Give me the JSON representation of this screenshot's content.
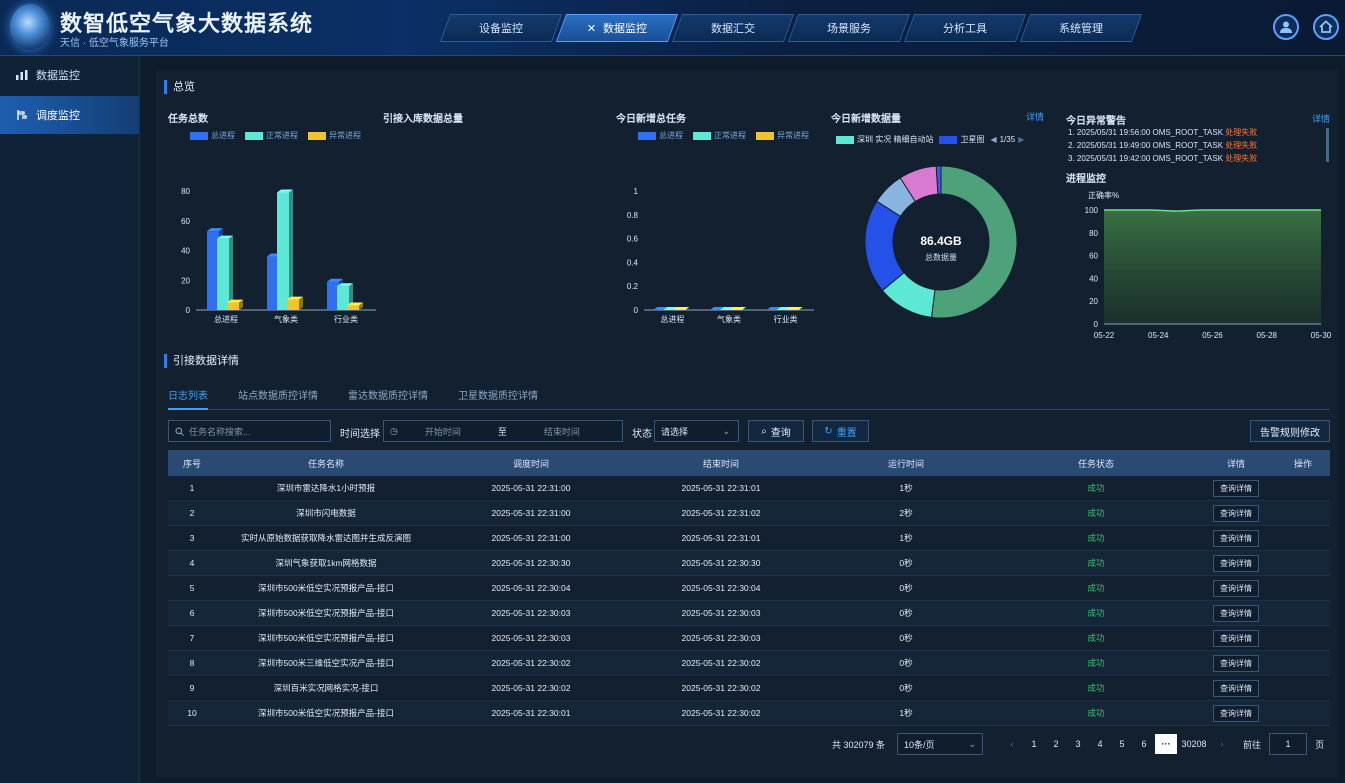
{
  "header": {
    "title": "数智低空气象大数据系统",
    "subtitle": "天信 · 低空气象服务平台",
    "nav": [
      "设备监控",
      "数据监控",
      "数据汇交",
      "场景服务",
      "分析工具",
      "系统管理"
    ]
  },
  "sidebar": {
    "items": [
      "数据监控",
      "调度监控"
    ]
  },
  "overview": {
    "title": "总览",
    "task_total_label": "任务总数",
    "ingest_total_label": "引接入库数据总量",
    "new_tasks_label": "今日新增总任务",
    "new_data_label": "今日新增数据量",
    "new_data_link": "详情",
    "alerts_label": "今日异常警告",
    "alerts_link": "详情",
    "process_label": "进程监控",
    "legend_total": "总进程",
    "legend_normal": "正常进程",
    "legend_abnormal": "异常进程",
    "donut_legend_a": "深圳 实况 精细自动站",
    "donut_legend_b": "卫星图",
    "donut_pager": "1/35",
    "donut_value": "86.4GB",
    "donut_caption": "总数据量",
    "process_axis_label": "正确率%",
    "alerts": [
      {
        "idx": "1.",
        "text": "2025/05/31 19:56:00 OMS_ROOT_TASK",
        "status": "处理失败"
      },
      {
        "idx": "2.",
        "text": "2025/05/31 19:49:00 OMS_ROOT_TASK",
        "status": "处理失败"
      },
      {
        "idx": "3.",
        "text": "2025/05/31 19:42:00 OMS_ROOT_TASK",
        "status": "处理失败"
      }
    ]
  },
  "chart_data": [
    {
      "type": "bar",
      "title": "任务总数",
      "categories": [
        "总进程",
        "气象类",
        "行业类"
      ],
      "ylim": [
        0,
        80
      ],
      "yticks": [
        0,
        20,
        40,
        60,
        80
      ],
      "series": [
        {
          "name": "总进程",
          "values": [
            53,
            36,
            19
          ],
          "color": "#2f6ff0"
        },
        {
          "name": "正常进程",
          "values": [
            48,
            79,
            16
          ],
          "color": "#5de8d6"
        },
        {
          "name": "异常进程",
          "values": [
            5,
            7,
            3
          ],
          "color": "#f0c330"
        }
      ]
    },
    {
      "type": "bar",
      "title": "今日新增总任务",
      "categories": [
        "总进程",
        "气象类",
        "行业类"
      ],
      "ylim": [
        0,
        1
      ],
      "yticks": [
        0,
        0.2,
        0.4,
        0.6,
        0.8,
        1
      ],
      "series": [
        {
          "name": "总进程",
          "values": [
            0,
            0,
            0
          ],
          "color": "#2f6ff0"
        },
        {
          "name": "正常进程",
          "values": [
            0,
            0,
            0
          ],
          "color": "#5de8d6"
        },
        {
          "name": "异常进程",
          "values": [
            0,
            0,
            0
          ],
          "color": "#f0c330"
        }
      ]
    },
    {
      "type": "pie",
      "title": "今日新增数据量",
      "slices": [
        {
          "name": "green",
          "value": 52,
          "color": "#4ea27a"
        },
        {
          "name": "cyan",
          "value": 12,
          "color": "#5de8d6"
        },
        {
          "name": "blue",
          "value": 20,
          "color": "#2452e8"
        },
        {
          "name": "lightblue",
          "value": 7,
          "color": "#8ab4e0"
        },
        {
          "name": "pink",
          "value": 8,
          "color": "#d77ad0"
        },
        {
          "name": "darkblue",
          "value": 1,
          "color": "#3f5be0"
        }
      ]
    },
    {
      "type": "area",
      "title": "进程监控",
      "ylabel": "正确率%",
      "ylim": [
        0,
        100
      ],
      "yticks": [
        0,
        20,
        40,
        60,
        80,
        100
      ],
      "xticks": [
        "05-22",
        "05-24",
        "05-26",
        "05-28",
        "05-30"
      ],
      "values": [
        100,
        100,
        100,
        99,
        100,
        100,
        100,
        100,
        100,
        100
      ]
    }
  ],
  "details": {
    "title": "引接数据详情",
    "tabs": [
      "日志列表",
      "站点数据质控详情",
      "雷达数据质控详情",
      "卫星数据质控详情"
    ],
    "search_placeholder": "任务名称搜索...",
    "time_label": "时间选择",
    "start_placeholder": "开始时间",
    "to": "至",
    "end_placeholder": "结束时间",
    "status_label": "状态",
    "status_select": "请选择",
    "query_btn": "查询",
    "reset_btn": "重置",
    "rule_btn": "告警规则修改",
    "columns": [
      "序号",
      "任务名称",
      "调度时间",
      "结束时间",
      "运行时间",
      "任务状态",
      "详情",
      "操作"
    ],
    "rows": [
      [
        "1",
        "深圳市雷达降水1小时预报",
        "2025-05-31 22:31:00",
        "2025-05-31 22:31:01",
        "1秒",
        "成功",
        "查询详情"
      ],
      [
        "2",
        "深圳市闪电数据",
        "2025-05-31 22:31:00",
        "2025-05-31 22:31:02",
        "2秒",
        "成功",
        "查询详情"
      ],
      [
        "3",
        "实时从原始数据获取降水雷达图并生成反演图",
        "2025-05-31 22:31:00",
        "2025-05-31 22:31:01",
        "1秒",
        "成功",
        "查询详情"
      ],
      [
        "4",
        "深圳气象获取1km网格数据",
        "2025-05-31 22:30:30",
        "2025-05-31 22:30:30",
        "0秒",
        "成功",
        "查询详情"
      ],
      [
        "5",
        "深圳市500米低空实况预报产品-接口",
        "2025-05-31 22:30:04",
        "2025-05-31 22:30:04",
        "0秒",
        "成功",
        "查询详情"
      ],
      [
        "6",
        "深圳市500米低空实况预报产品-接口",
        "2025-05-31 22:30:03",
        "2025-05-31 22:30:03",
        "0秒",
        "成功",
        "查询详情"
      ],
      [
        "7",
        "深圳市500米低空实况预报产品-接口",
        "2025-05-31 22:30:03",
        "2025-05-31 22:30:03",
        "0秒",
        "成功",
        "查询详情"
      ],
      [
        "8",
        "深圳市500米三维低空实况产品-接口",
        "2025-05-31 22:30:02",
        "2025-05-31 22:30:02",
        "0秒",
        "成功",
        "查询详情"
      ],
      [
        "9",
        "深圳百米实况网格实况-接口",
        "2025-05-31 22:30:02",
        "2025-05-31 22:30:02",
        "0秒",
        "成功",
        "查询详情"
      ],
      [
        "10",
        "深圳市500米低空实况预报产品-接口",
        "2025-05-31 22:30:01",
        "2025-05-31 22:30:02",
        "1秒",
        "成功",
        "查询详情"
      ]
    ],
    "pager": {
      "total": "共 302079 条",
      "page_size": "10条/页",
      "pages": [
        "1",
        "2",
        "3",
        "4",
        "5",
        "6"
      ],
      "ellipsis": "···",
      "last": "30208",
      "goto_label": "前往",
      "goto_value": "1",
      "goto_suffix": "页"
    }
  }
}
